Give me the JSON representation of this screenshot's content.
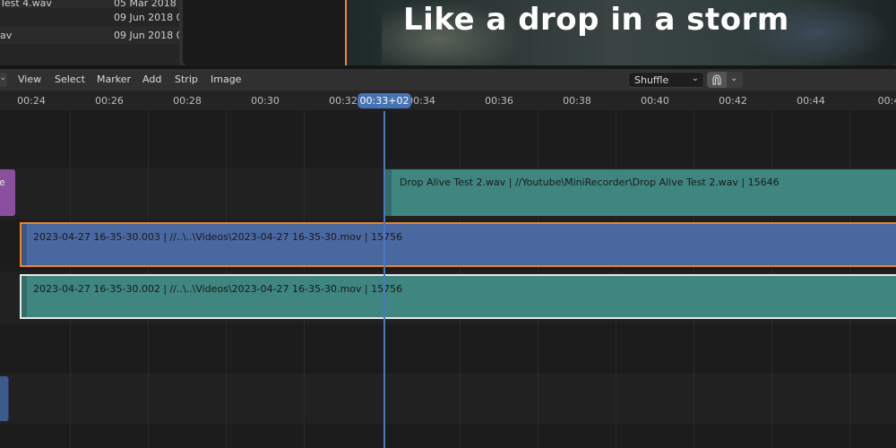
{
  "file_browser": {
    "rows": [
      {
        "name": "Test 4.wav",
        "date": "05 Mar 2018 0"
      },
      {
        "name": "",
        "date": "09 Jun 2018 0"
      },
      {
        "name": "av",
        "date": "09 Jun 2018 0"
      },
      {
        "name": "",
        "date": ""
      }
    ]
  },
  "preview": {
    "subtitle": "Like a drop in a storm",
    "edge_color": "#e88a2a"
  },
  "header": {
    "editor_type_chevron": "⌄",
    "menu": [
      "View",
      "Select",
      "Marker",
      "Add",
      "Strip",
      "Image"
    ],
    "overlap_mode": "Shuffle",
    "snap_icon": "snap-magnet-icon"
  },
  "ruler": {
    "ticks": [
      "00:24",
      "00:26",
      "00:28",
      "00:30",
      "00:32",
      "00:34",
      "00:36",
      "00:38",
      "00:40",
      "00:42",
      "00:44",
      "00:4"
    ],
    "current_time": "00:33+02"
  },
  "strips": {
    "purple_partial": {
      "label": "e",
      "color": "#8a4f9e"
    },
    "sound": {
      "label": "Drop Alive Test 2.wav | //Youtube\\MiniRecorder\\Drop Alive Test 2.wav | 15646",
      "color": "#3f8580"
    },
    "movie_selected": {
      "label": "2023-04-27 16-35-30.003 | //..\\..\\Videos\\2023-04-27 16-35-30.mov | 15756",
      "color": "#4a68a0"
    },
    "movie_active": {
      "label": "2023-04-27 16-35-30.002 | //..\\..\\Videos\\2023-04-27 16-35-30.mov | 15756",
      "color": "#3f8580"
    },
    "blue_partial": {
      "label": "",
      "color": "#3c5a8c"
    }
  },
  "colors": {
    "playhead": "#4a78c0",
    "selection_outline": "#e6862b",
    "active_outline": "#e8e8e8"
  }
}
